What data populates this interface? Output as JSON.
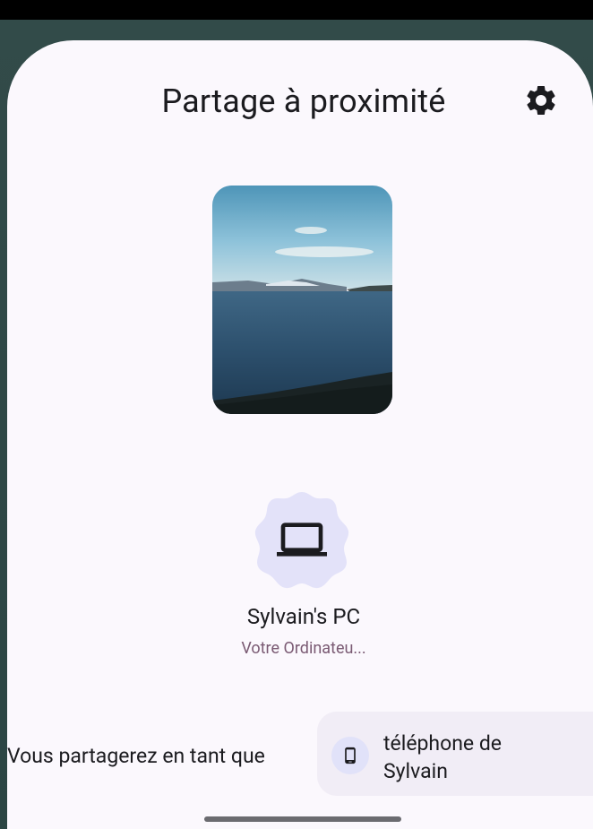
{
  "sheet": {
    "title": "Partage à proximité"
  },
  "icons": {
    "settings": "gear-icon",
    "laptop": "laptop-icon",
    "phone": "smartphone-icon"
  },
  "preview": {
    "description_icon": "image-thumbnail"
  },
  "target_device": {
    "name": "Sylvain's PC",
    "subtitle": "Votre Ordinateu..."
  },
  "share_identity": {
    "label": "Vous partagerez en tant que",
    "device_name_line1": "téléphone de",
    "device_name_line2": "Sylvain"
  },
  "colors": {
    "sheet_background": "#fbf8fd",
    "device_bubble": "#e3e2f9",
    "subtitle_text": "#7a5a73",
    "chip_background": "#f1edf6"
  }
}
